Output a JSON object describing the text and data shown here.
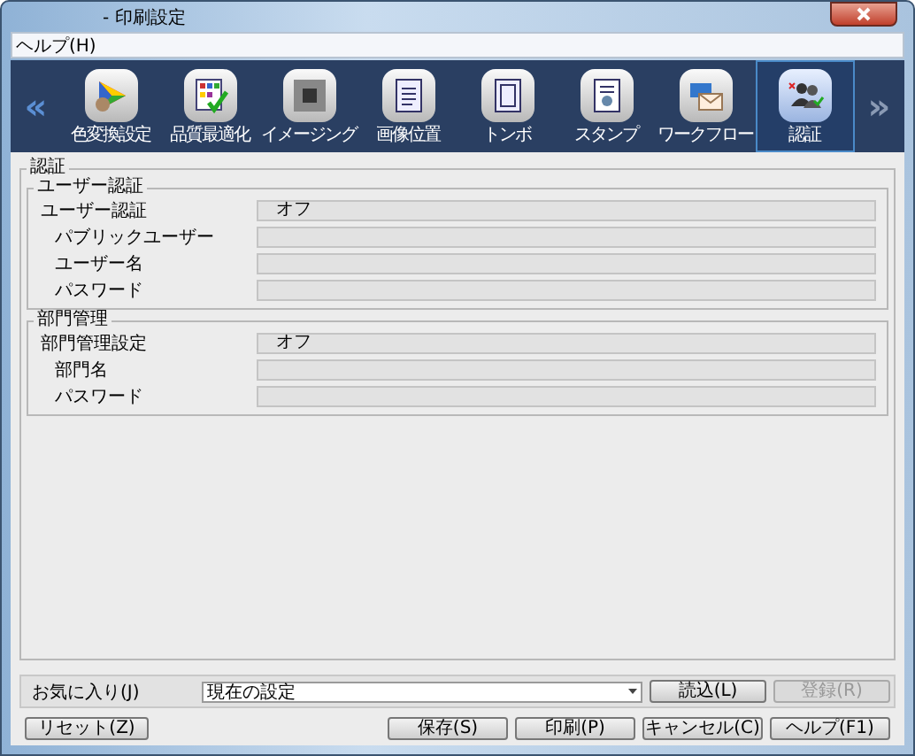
{
  "window": {
    "title": "- 印刷設定"
  },
  "menu": [
    "ヘルプ(H)"
  ],
  "toolbar": {
    "prev": "«",
    "next": "»",
    "items": [
      {
        "label": "色変換設定",
        "selected": false
      },
      {
        "label": "品質最適化",
        "selected": false
      },
      {
        "label": "イメージング",
        "selected": false
      },
      {
        "label": "画像位置",
        "selected": false
      },
      {
        "label": "トンボ",
        "selected": false
      },
      {
        "label": "スタンプ",
        "selected": false
      },
      {
        "label": "ワークフロー",
        "selected": false
      },
      {
        "label": "認証",
        "selected": true
      }
    ]
  },
  "section": {
    "title": "認証",
    "groups": [
      {
        "title": "ユーザー認証",
        "fields": [
          {
            "label": "ユーザー認証",
            "value": "オフ",
            "indented": false
          },
          {
            "label": "パブリックユーザー",
            "indented": true
          },
          {
            "label": "ユーザー名",
            "indented": true
          },
          {
            "label": "パスワード",
            "indented": true
          }
        ]
      },
      {
        "title": "部門管理",
        "fields": [
          {
            "label": "部門管理設定",
            "value": "オフ",
            "indented": false
          },
          {
            "label": "部門名",
            "indented": true
          },
          {
            "label": "パスワード",
            "indented": true
          }
        ]
      }
    ]
  },
  "favorites": {
    "label": "お気に入り(J)",
    "value": "現在の設定",
    "buttons": [
      {
        "label": "読込(L)",
        "disabled": false
      },
      {
        "label": "登録(R)",
        "disabled": true
      }
    ]
  },
  "left_buttons": [
    "リセット(Z)"
  ],
  "buttons": [
    "保存(S)",
    "印刷(P)",
    "キャンセル(C)",
    "ヘルプ(F1)"
  ]
}
